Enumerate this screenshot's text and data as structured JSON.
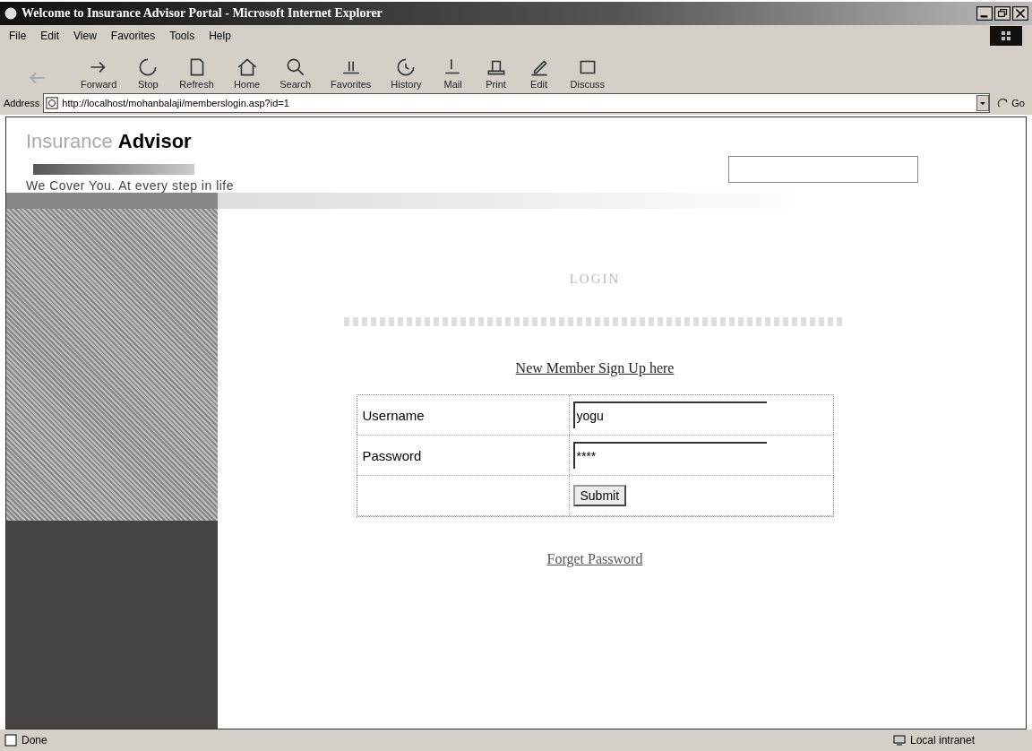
{
  "window": {
    "title": "Welcome to Insurance Advisor Portal - Microsoft Internet Explorer"
  },
  "menu": [
    "File",
    "Edit",
    "View",
    "Favorites",
    "Tools",
    "Help"
  ],
  "toolbar": [
    {
      "label": "Forward"
    },
    {
      "label": "Stop"
    },
    {
      "label": "Refresh"
    },
    {
      "label": "Home"
    },
    {
      "label": "Search"
    },
    {
      "label": "Favorites"
    },
    {
      "label": "History"
    },
    {
      "label": "Mail"
    },
    {
      "label": "Print"
    },
    {
      "label": "Edit"
    },
    {
      "label": "Discuss"
    }
  ],
  "address": {
    "label": "Address",
    "url": "http://localhost/mohanbalaji/memberslogin.asp?id=1",
    "go": "Go"
  },
  "header": {
    "title_light": "Insurance",
    "title_bold": "Advisor",
    "tagline": "We Cover You. At every step in life"
  },
  "login": {
    "heading": "LOGIN",
    "signup_link": "New Member Sign Up here",
    "fields": [
      {
        "label": "Username",
        "value": "yogu"
      },
      {
        "label": "Password",
        "value": "****"
      }
    ],
    "submit": "Submit",
    "forgot_link": "Forget Password"
  },
  "status_bar": {
    "text": "Done",
    "zone": "Local intranet"
  }
}
